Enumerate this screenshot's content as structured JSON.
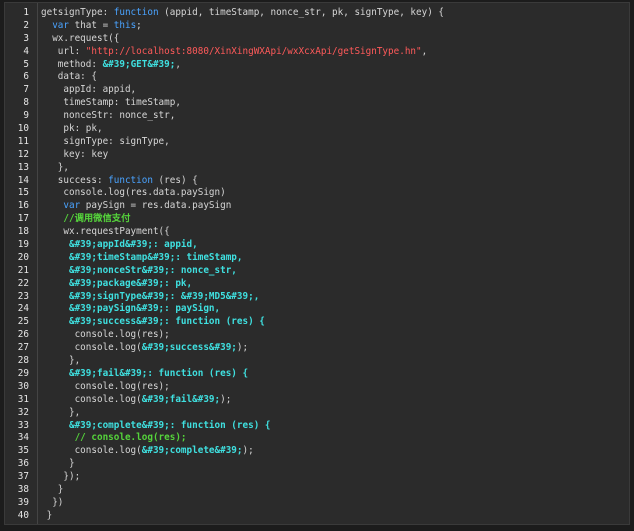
{
  "code_lines": [
    {
      "n": "1",
      "segs": [
        {
          "t": "getsignType: ",
          "c": "p"
        },
        {
          "t": "function",
          "c": "k"
        },
        {
          "t": " (appid, timeStamp, nonce_str, pk, signType, key) {",
          "c": "p"
        }
      ]
    },
    {
      "n": "2",
      "segs": [
        {
          "t": "  ",
          "c": "p"
        },
        {
          "t": "var",
          "c": "k"
        },
        {
          "t": " that = ",
          "c": "p"
        },
        {
          "t": "this",
          "c": "k"
        },
        {
          "t": ";",
          "c": "p"
        }
      ]
    },
    {
      "n": "3",
      "segs": [
        {
          "t": "  wx.request({",
          "c": "p"
        }
      ]
    },
    {
      "n": "4",
      "segs": [
        {
          "t": "   url: ",
          "c": "p"
        },
        {
          "t": "\"http://localhost:8080/XinXingWXApi/wxXcxApi/getSignType.hn\"",
          "c": "s"
        },
        {
          "t": ",",
          "c": "p"
        }
      ]
    },
    {
      "n": "5",
      "segs": [
        {
          "t": "   method: ",
          "c": "p"
        },
        {
          "t": "&#39;GET&#39;",
          "c": "b"
        },
        {
          "t": ",",
          "c": "p"
        }
      ]
    },
    {
      "n": "6",
      "segs": [
        {
          "t": "   data: {",
          "c": "p"
        }
      ]
    },
    {
      "n": "7",
      "segs": [
        {
          "t": "    appId: appid,",
          "c": "p"
        }
      ]
    },
    {
      "n": "8",
      "segs": [
        {
          "t": "    timeStamp: timeStamp,",
          "c": "p"
        }
      ]
    },
    {
      "n": "9",
      "segs": [
        {
          "t": "    nonceStr: nonce_str,",
          "c": "p"
        }
      ]
    },
    {
      "n": "10",
      "segs": [
        {
          "t": "    pk: pk,",
          "c": "p"
        }
      ]
    },
    {
      "n": "11",
      "segs": [
        {
          "t": "    signType: signType,",
          "c": "p"
        }
      ]
    },
    {
      "n": "12",
      "segs": [
        {
          "t": "    key: key",
          "c": "p"
        }
      ]
    },
    {
      "n": "13",
      "segs": [
        {
          "t": "   },",
          "c": "p"
        }
      ]
    },
    {
      "n": "14",
      "segs": [
        {
          "t": "   success: ",
          "c": "p"
        },
        {
          "t": "function",
          "c": "k"
        },
        {
          "t": " (res) {",
          "c": "p"
        }
      ]
    },
    {
      "n": "15",
      "segs": [
        {
          "t": "    console.log(res.data.paySign)",
          "c": "p"
        }
      ]
    },
    {
      "n": "16",
      "segs": [
        {
          "t": "    ",
          "c": "p"
        },
        {
          "t": "var",
          "c": "k"
        },
        {
          "t": " paySign = res.data.paySign",
          "c": "p"
        }
      ]
    },
    {
      "n": "17",
      "segs": [
        {
          "t": "    //调用微信支付",
          "c": "c"
        }
      ]
    },
    {
      "n": "18",
      "segs": [
        {
          "t": "    wx.requestPayment({",
          "c": "p"
        }
      ]
    },
    {
      "n": "19",
      "segs": [
        {
          "t": "     &#39;appId&#39;: appid,",
          "c": "b"
        }
      ]
    },
    {
      "n": "20",
      "segs": [
        {
          "t": "     &#39;timeStamp&#39;: timeStamp,",
          "c": "b"
        }
      ]
    },
    {
      "n": "21",
      "segs": [
        {
          "t": "     &#39;nonceStr&#39;: nonce_str,",
          "c": "b"
        }
      ]
    },
    {
      "n": "22",
      "segs": [
        {
          "t": "     &#39;package&#39;: pk,",
          "c": "b"
        }
      ]
    },
    {
      "n": "23",
      "segs": [
        {
          "t": "     &#39;signType&#39;: &#39;MD5&#39;,",
          "c": "b"
        }
      ]
    },
    {
      "n": "24",
      "segs": [
        {
          "t": "     &#39;paySign&#39;: paySign,",
          "c": "b"
        }
      ]
    },
    {
      "n": "25",
      "segs": [
        {
          "t": "     &#39;success&#39;: function (res) {",
          "c": "b"
        }
      ]
    },
    {
      "n": "26",
      "segs": [
        {
          "t": "      console.log(res);",
          "c": "p"
        }
      ]
    },
    {
      "n": "27",
      "segs": [
        {
          "t": "      console.log(",
          "c": "p"
        },
        {
          "t": "&#39;success&#39;",
          "c": "b"
        },
        {
          "t": ");",
          "c": "p"
        }
      ]
    },
    {
      "n": "28",
      "segs": [
        {
          "t": "     },",
          "c": "p"
        }
      ]
    },
    {
      "n": "29",
      "segs": [
        {
          "t": "     &#39;fail&#39;: function (res) {",
          "c": "b"
        }
      ]
    },
    {
      "n": "30",
      "segs": [
        {
          "t": "      console.log(res);",
          "c": "p"
        }
      ]
    },
    {
      "n": "31",
      "segs": [
        {
          "t": "      console.log(",
          "c": "p"
        },
        {
          "t": "&#39;fail&#39;",
          "c": "b"
        },
        {
          "t": ");",
          "c": "p"
        }
      ]
    },
    {
      "n": "32",
      "segs": [
        {
          "t": "     },",
          "c": "p"
        }
      ]
    },
    {
      "n": "33",
      "segs": [
        {
          "t": "     &#39;complete&#39;: function (res) {",
          "c": "b"
        }
      ]
    },
    {
      "n": "34",
      "segs": [
        {
          "t": "      // console.log(res);",
          "c": "c"
        }
      ]
    },
    {
      "n": "35",
      "segs": [
        {
          "t": "      console.log(",
          "c": "p"
        },
        {
          "t": "&#39;complete&#39;",
          "c": "b"
        },
        {
          "t": ");",
          "c": "p"
        }
      ]
    },
    {
      "n": "36",
      "segs": [
        {
          "t": "     }",
          "c": "p"
        }
      ]
    },
    {
      "n": "37",
      "segs": [
        {
          "t": "    });",
          "c": "p"
        }
      ]
    },
    {
      "n": "38",
      "segs": [
        {
          "t": "   }",
          "c": "p"
        }
      ]
    },
    {
      "n": "39",
      "segs": [
        {
          "t": "  })",
          "c": "p"
        }
      ]
    },
    {
      "n": "40",
      "segs": [
        {
          "t": " }",
          "c": "p"
        }
      ]
    }
  ]
}
